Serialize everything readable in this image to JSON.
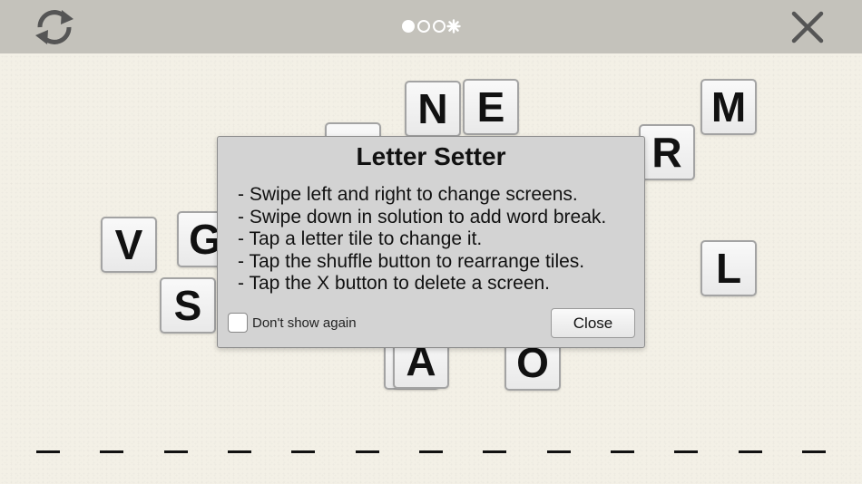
{
  "toolbar": {
    "refresh_icon": "refresh-icon",
    "close_icon": "close-x-icon",
    "page_indicator": {
      "total_pages": 4,
      "current_page": 1,
      "last_indicator": "star"
    }
  },
  "tiles": [
    "N",
    "E",
    "M",
    "R",
    "V",
    "G",
    "L",
    "S",
    "A",
    "O"
  ],
  "solution": {
    "slot_count": 13
  },
  "dialog": {
    "title": "Letter Setter",
    "lines": [
      "- Swipe left and right to change screens.",
      "- Swipe down in solution to add word break.",
      "- Tap a letter tile to change it.",
      "- Tap the shuffle button to rearrange tiles.",
      "- Tap the X button to delete a screen."
    ],
    "checkbox_label": "Don't show again",
    "checkbox_checked": false,
    "close_label": "Close"
  },
  "colors": {
    "toolbar_bg": "#c4c2bb",
    "page_bg": "#f3f0e6",
    "dialog_bg": "#d3d3d3",
    "icon_color": "#555555"
  }
}
